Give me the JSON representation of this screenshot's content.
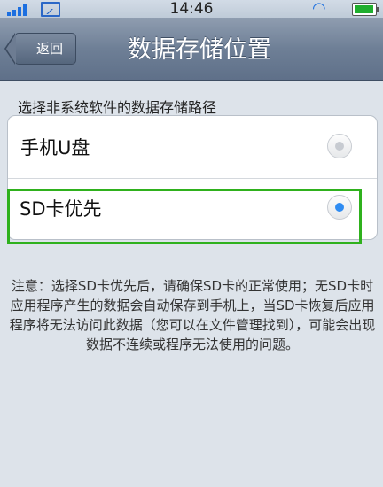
{
  "status_bar": {
    "time": "14:46"
  },
  "nav": {
    "back_label": "返回",
    "title": "数据存储位置"
  },
  "section": {
    "label": "选择非系统软件的数据存储路径"
  },
  "options": [
    {
      "label": "手机U盘",
      "selected": false
    },
    {
      "label": "SD卡优先",
      "selected": true
    }
  ],
  "note": {
    "text": "注意：选择SD卡优先后，请确保SD卡的正常使用；无SD卡时应用程序产生的数据会自动保存到手机上，当SD卡恢复后应用程序将无法访问此数据（您可以在文件管理找到），可能会出现数据不连续或程序无法使用的问题。"
  },
  "colors": {
    "accent": "#2f8cf2",
    "highlight": "#2fb11d",
    "nav_bar": "#6e7f96"
  }
}
